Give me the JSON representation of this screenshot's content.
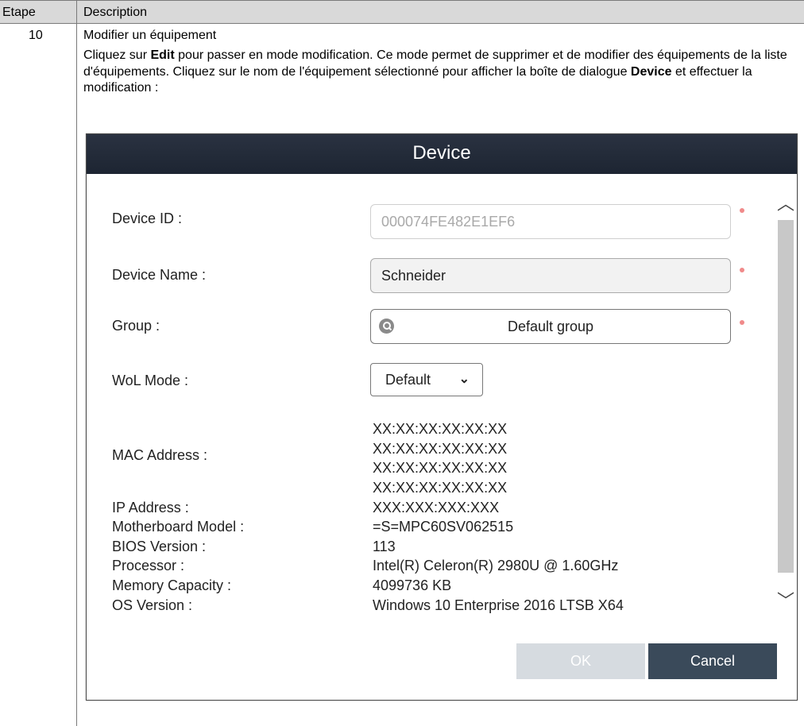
{
  "table": {
    "header_step": "Etape",
    "header_description": "Description"
  },
  "step": {
    "number": "10",
    "title": "Modifier un équipement",
    "para_part1": "Cliquez sur ",
    "para_edit": "Edit",
    "para_part2": " pour passer en mode modification. Ce mode permet de supprimer et de modifier des équipements de la liste d'équipements. Cliquez sur le nom de l'équipement sélectionné pour afficher la boîte de dialogue ",
    "para_device": "Device",
    "para_part3": " et effectuer la modification :"
  },
  "dialog": {
    "title": "Device",
    "fields": {
      "device_id_label": "Device ID :",
      "device_id_value": "000074FE482E1EF6",
      "device_name_label": "Device Name :",
      "device_name_value": "Schneider",
      "group_label": "Group :",
      "group_value": "Default group",
      "wol_label": "WoL Mode :",
      "wol_value": "Default",
      "mac_label": "MAC Address :",
      "mac_values": [
        "XX:XX:XX:XX:XX:XX",
        "XX:XX:XX:XX:XX:XX",
        "XX:XX:XX:XX:XX:XX",
        "XX:XX:XX:XX:XX:XX"
      ],
      "ip_label": "IP Address :",
      "ip_value": "XXX:XXX:XXX:XXX",
      "motherboard_label": "Motherboard Model :",
      "motherboard_value": "=S=MPC60SV062515",
      "bios_label": "BIOS Version :",
      "bios_value": "113",
      "processor_label": "Processor :",
      "processor_value": "Intel(R) Celeron(R) 2980U @ 1.60GHz",
      "memory_label": "Memory Capacity :",
      "memory_value": "4099736 KB",
      "os_label": "OS Version :",
      "os_value": "Windows 10 Enterprise 2016 LTSB X64"
    },
    "buttons": {
      "ok": "OK",
      "cancel": "Cancel"
    },
    "colors": {
      "header_bg": "#222a37",
      "required_dot": "#f08a8a",
      "cancel_bg": "#3a4a5a",
      "ok_bg": "#d6dbe0"
    },
    "icons": {
      "group_search": "search-icon",
      "wol_dropdown": "double-chevron-down-icon",
      "scroll_up": "chevron-up-icon",
      "scroll_down": "chevron-down-icon"
    }
  }
}
